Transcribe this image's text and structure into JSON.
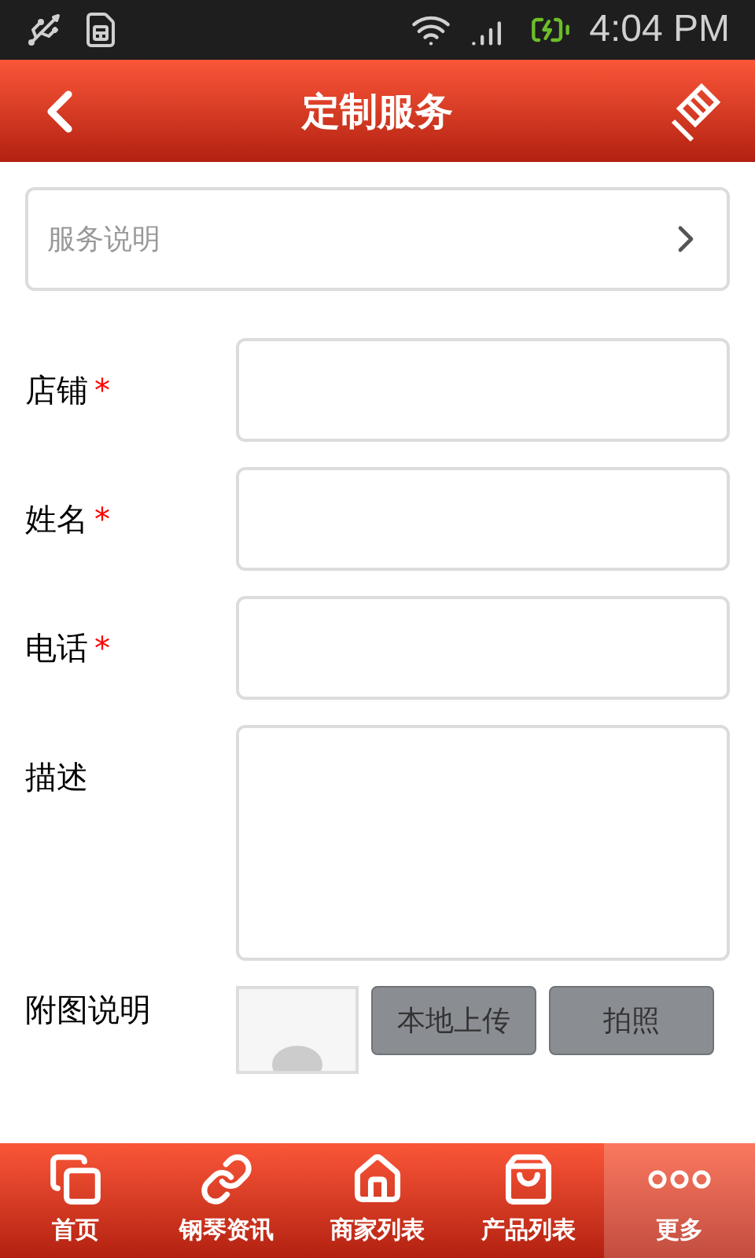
{
  "status_bar": {
    "time": "4:04 PM"
  },
  "header": {
    "title": "定制服务"
  },
  "service_link": {
    "label": "服务说明"
  },
  "fields": [
    {
      "label": "店铺",
      "required_mark": "*",
      "kind": "input"
    },
    {
      "label": "姓名",
      "required_mark": "*",
      "kind": "input"
    },
    {
      "label": "电话",
      "required_mark": "*",
      "kind": "input"
    },
    {
      "label": "描述",
      "kind": "textarea"
    }
  ],
  "attachment": {
    "label": "附图说明",
    "buttons": [
      "本地上传",
      "拍照"
    ]
  },
  "nav": [
    {
      "label": "首页",
      "selected": false
    },
    {
      "label": "钢琴资讯",
      "selected": false
    },
    {
      "label": "商家列表",
      "selected": false
    },
    {
      "label": "产品列表",
      "selected": false
    },
    {
      "label": "更多",
      "selected": true
    }
  ]
}
